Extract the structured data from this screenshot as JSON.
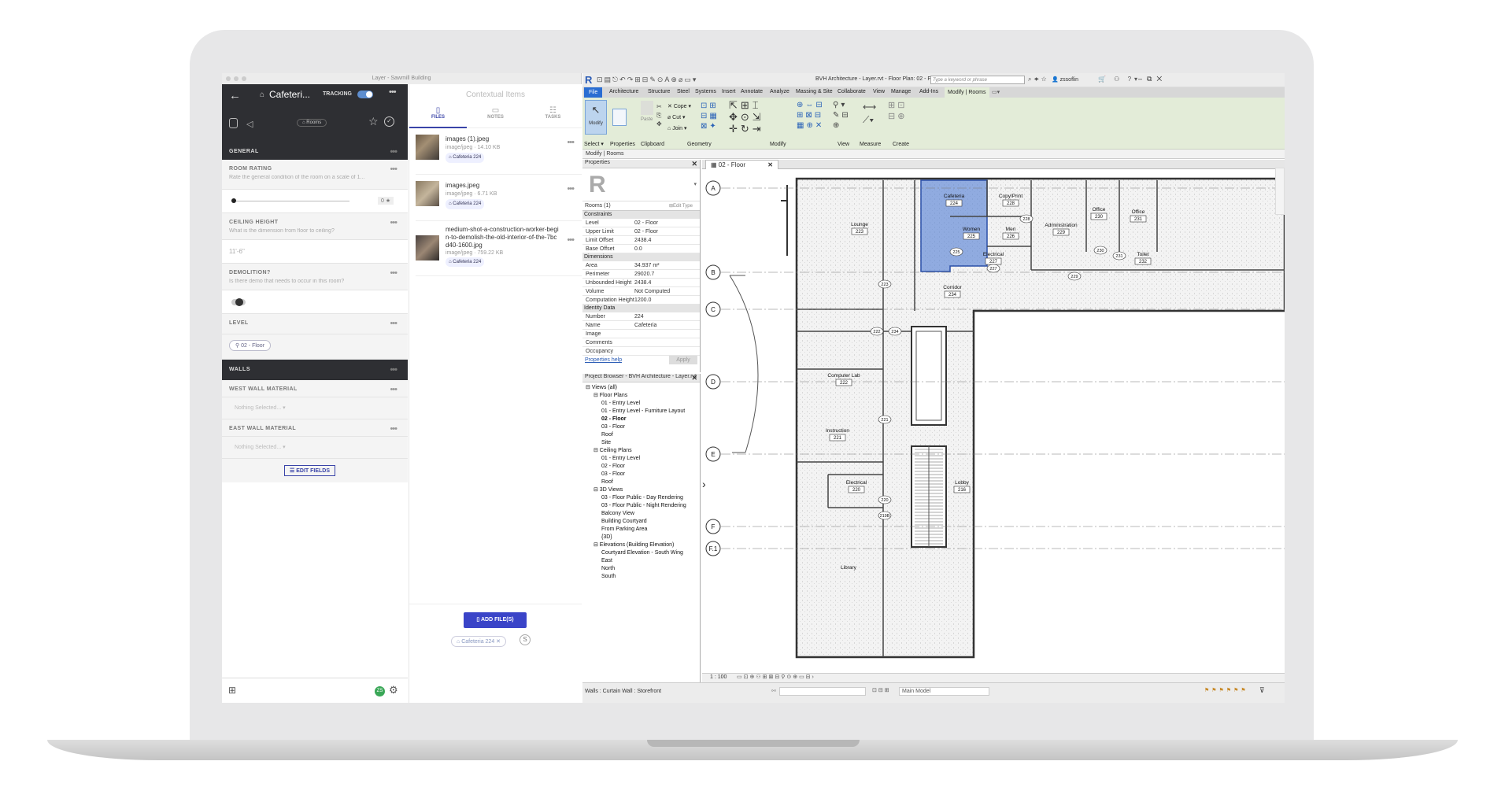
{
  "layer": {
    "window_title": "Layer - Sawmill Building",
    "room_title": "Cafeteri...",
    "tracking_label": "TRACKING",
    "rooms_chip": "Rooms",
    "sections": {
      "general": "GENERAL",
      "walls": "WALLS"
    },
    "fields": {
      "room_rating": {
        "label": "ROOM RATING",
        "desc": "Rate the general condition of the room on a scale of 1...",
        "value": "0 ★"
      },
      "ceiling_height": {
        "label": "CEILING HEIGHT",
        "desc": "What is the dimension from floor to ceiling?",
        "value": "11'-6\""
      },
      "demolition": {
        "label": "DEMOLITION?",
        "desc": "Is there demo that needs to occur in this room?"
      },
      "level": {
        "label": "LEVEL",
        "value": "02 - Floor"
      },
      "west_wall": {
        "label": "WEST WALL MATERIAL",
        "value": "Nothing Selected..."
      },
      "east_wall": {
        "label": "EAST WALL MATERIAL",
        "value": "Nothing Selected..."
      }
    },
    "edit_fields": "EDIT FIELDS",
    "avatar": "ZS",
    "contextual_title": "Contextual Items",
    "tabs": {
      "files": "FILES",
      "notes": "NOTES",
      "tasks": "TASKS"
    },
    "files": [
      {
        "name": "images (1).jpeg",
        "meta": "image/jpeg · 14.10 KB",
        "tag": "Cafeteria 224"
      },
      {
        "name": "images.jpeg",
        "meta": "image/jpeg · 6.71 KB",
        "tag": "Cafeteria 224"
      },
      {
        "name": "medium-shot-a-construction-worker-begin-to-demolish-the-old-interior-of-the-7bcd40-1600.jpg",
        "meta": "image/jpeg · 759.22 KB",
        "tag": "Cafeteria 224"
      }
    ],
    "add_files": "ADD FILE(S)",
    "filter_chip": "Cafeteria 224"
  },
  "revit": {
    "title": "BVH Architecture - Layer.rvt - Floor Plan: 02 - Floor",
    "search_placeholder": "Type a keyword or phrase",
    "user": "zssoflin",
    "tabs": [
      "File",
      "Architecture",
      "Structure",
      "Steel",
      "Systems",
      "Insert",
      "Annotate",
      "Analyze",
      "Massing & Site",
      "Collaborate",
      "View",
      "Manage",
      "Add-Ins",
      "Modify | Rooms"
    ],
    "ribbon": {
      "modify": "Modify",
      "cope": "Cope",
      "cut": "Cut",
      "join": "Join",
      "paste": "Paste",
      "groups": {
        "select": "Select",
        "properties": "Properties",
        "clipboard": "Clipboard",
        "geometry": "Geometry",
        "modify": "Modify",
        "view": "View",
        "measure": "Measure",
        "create": "Create"
      }
    },
    "context": "Modify | Rooms",
    "properties": {
      "title": "Properties",
      "type_selector": "Rooms (1)",
      "edit_type": "Edit Type",
      "groups": {
        "constraints": "Constraints",
        "dimensions": "Dimensions",
        "identity": "Identity Data"
      },
      "constraints": [
        [
          "Level",
          "02 - Floor"
        ],
        [
          "Upper Limit",
          "02 - Floor"
        ],
        [
          "Limit Offset",
          "2438.4"
        ],
        [
          "Base Offset",
          "0.0"
        ]
      ],
      "dimensions": [
        [
          "Area",
          "34.937 m²"
        ],
        [
          "Perimeter",
          "29020.7"
        ],
        [
          "Unbounded Height",
          "2438.4"
        ],
        [
          "Volume",
          "Not Computed"
        ],
        [
          "Computation Height",
          "1200.0"
        ]
      ],
      "identity": [
        [
          "Number",
          "224"
        ],
        [
          "Name",
          "Cafeteria"
        ],
        [
          "Image",
          ""
        ],
        [
          "Comments",
          ""
        ],
        [
          "Occupancy",
          ""
        ]
      ],
      "help": "Properties help",
      "apply": "Apply"
    },
    "browser": {
      "title": "Project Browser - BVH Architecture - Layer.rvt",
      "nodes": [
        {
          "t": "Views (all)",
          "l": 0
        },
        {
          "t": "Floor Plans",
          "l": 1
        },
        {
          "t": "01 - Entry Level",
          "l": 2
        },
        {
          "t": "01 - Entry Level - Furniture Layout",
          "l": 2
        },
        {
          "t": "02 - Floor",
          "l": 2,
          "b": true
        },
        {
          "t": "03 - Floor",
          "l": 2
        },
        {
          "t": "Roof",
          "l": 2
        },
        {
          "t": "Site",
          "l": 2
        },
        {
          "t": "Ceiling Plans",
          "l": 1
        },
        {
          "t": "01 - Entry Level",
          "l": 2
        },
        {
          "t": "02 - Floor",
          "l": 2
        },
        {
          "t": "03 - Floor",
          "l": 2
        },
        {
          "t": "Roof",
          "l": 2
        },
        {
          "t": "3D Views",
          "l": 1
        },
        {
          "t": "03 - Floor Public - Day Rendering",
          "l": 2
        },
        {
          "t": "03 - Floor Public - Night Rendering",
          "l": 2
        },
        {
          "t": "Balcony View",
          "l": 2
        },
        {
          "t": "Building Courtyard",
          "l": 2
        },
        {
          "t": "From Parking Area",
          "l": 2
        },
        {
          "t": "{3D}",
          "l": 2
        },
        {
          "t": "Elevations (Building Elevation)",
          "l": 1
        },
        {
          "t": "Courtyard Elevation - South Wing",
          "l": 2
        },
        {
          "t": "East",
          "l": 2
        },
        {
          "t": "North",
          "l": 2
        },
        {
          "t": "South",
          "l": 2
        }
      ]
    },
    "view_tab": "02 - Floor",
    "grids": [
      "A",
      "B",
      "C",
      "D",
      "E",
      "F",
      "F.1"
    ],
    "rooms": [
      {
        "n": "Lounge",
        "num": "223"
      },
      {
        "n": "Cafeteria",
        "num": "224"
      },
      {
        "n": "Copy/Print",
        "num": "228"
      },
      {
        "n": "Administration",
        "num": "229"
      },
      {
        "n": "Office",
        "num": "230"
      },
      {
        "n": "Office",
        "num": "231"
      },
      {
        "n": "Women",
        "num": "225"
      },
      {
        "n": "Men",
        "num": "226"
      },
      {
        "n": "Electrical",
        "num": "227"
      },
      {
        "n": "Toilet",
        "num": "232"
      },
      {
        "n": "Corridor",
        "num": "234"
      },
      {
        "n": "Computer Lab",
        "num": "222"
      },
      {
        "n": "Instruction",
        "num": "221"
      },
      {
        "n": "Electrical",
        "num": "220"
      },
      {
        "n": "Lobby",
        "num": "216"
      },
      {
        "n": "Library",
        "num": ""
      }
    ],
    "tags": [
      "223",
      "225",
      "228",
      "230",
      "231",
      "229",
      "227",
      "222",
      "234",
      "221",
      "220",
      "219B"
    ],
    "scale": "1 : 100",
    "status": "Walls : Curtain Wall : Storefront",
    "model": "Main Model"
  }
}
